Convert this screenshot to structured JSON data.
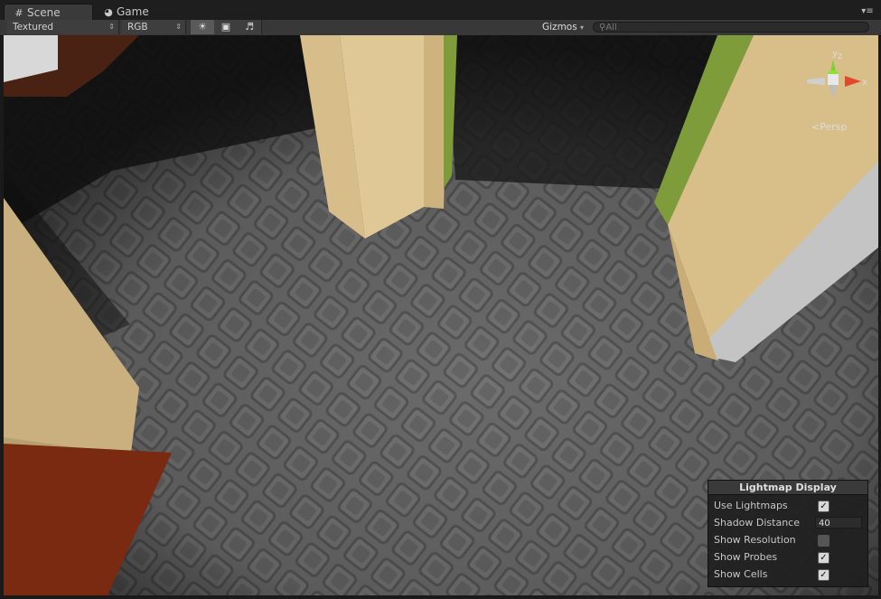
{
  "tabs": [
    {
      "label": "Scene",
      "icon": "grid-icon",
      "active": true
    },
    {
      "label": "Game",
      "icon": "pacman-icon",
      "active": false
    }
  ],
  "toolbar": {
    "render_mode": "Textured",
    "color_mode": "RGB",
    "icons": [
      "sun-icon",
      "image-icon",
      "audio-icon"
    ],
    "gizmos_label": "Gizmos",
    "search_placeholder": "All"
  },
  "scene_gizmo": {
    "axis_y": "y",
    "axis_z": "z",
    "axis_x": "x",
    "projection_label": "Persp",
    "colors": {
      "y": "#7bd12f",
      "x": "#e0492a",
      "center": "#d8d8d8"
    }
  },
  "lightmap_panel": {
    "title": "Lightmap Display",
    "rows": [
      {
        "label": "Use Lightmaps",
        "type": "checkbox",
        "checked": true
      },
      {
        "label": "Shadow Distance",
        "type": "number",
        "value": "40"
      },
      {
        "label": "Show Resolution",
        "type": "checkbox",
        "checked": false
      },
      {
        "label": "Show Probes",
        "type": "checkbox",
        "checked": true
      },
      {
        "label": "Show Cells",
        "type": "checkbox",
        "checked": true
      }
    ]
  }
}
